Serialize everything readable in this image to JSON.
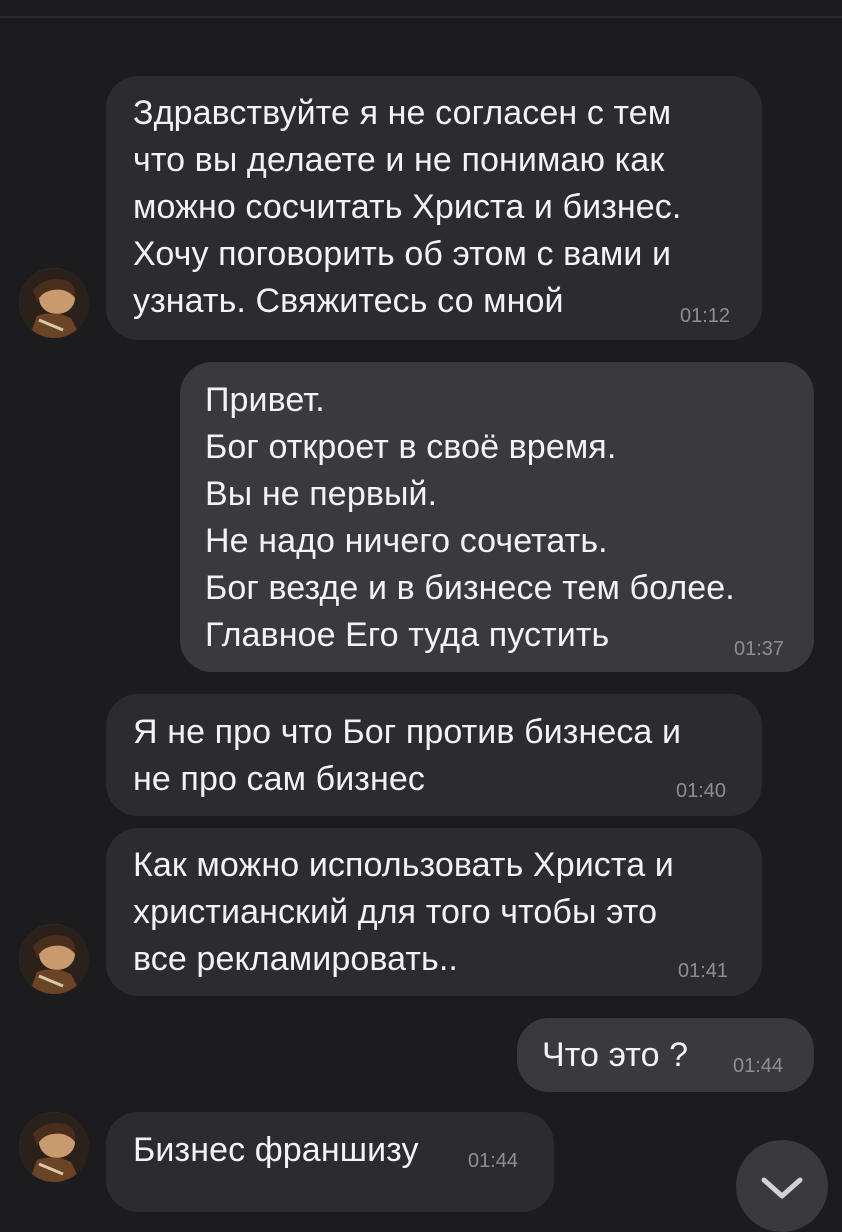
{
  "messages": [
    {
      "direction": "incoming",
      "lines": [
        "Здравствуйте я не согласен с тем",
        "что вы делаете и не понимаю как",
        "можно сосчитать Христа и бизнес.",
        "Хочу поговорить об этом с вами и",
        "узнать. Свяжитесь со мной"
      ],
      "time": "01:12",
      "avatar": true
    },
    {
      "direction": "outgoing",
      "lines": [
        "Привет.",
        "Бог откроет в своё время.",
        "Вы не первый.",
        "Не надо ничего сочетать.",
        "Бог везде и в бизнесе тем более.",
        "Главное Его туда пустить"
      ],
      "time": "01:37",
      "avatar": false
    },
    {
      "direction": "incoming",
      "lines": [
        "Я не про что Бог против бизнеса и",
        "не про сам бизнес"
      ],
      "time": "01:40",
      "avatar": false
    },
    {
      "direction": "incoming",
      "lines": [
        "Как можно использовать Христа и",
        "христианский для того чтобы это",
        "все рекламировать.."
      ],
      "time": "01:41",
      "avatar": true
    },
    {
      "direction": "outgoing",
      "lines": [
        "Что это ?"
      ],
      "time": "01:44",
      "avatar": false
    },
    {
      "direction": "incoming",
      "lines": [
        "Бизнес франшизу"
      ],
      "time": "01:44",
      "avatar": true
    }
  ],
  "icons": {
    "avatar": "contact-avatar-icon",
    "scroll": "chevron-down-icon"
  },
  "colors": {
    "background": "#1c1c1e",
    "incoming_bubble": "#2c2c2e",
    "outgoing_bubble": "#3a3a3c",
    "text": "#f2f2f7",
    "time": "#8e8e93"
  }
}
